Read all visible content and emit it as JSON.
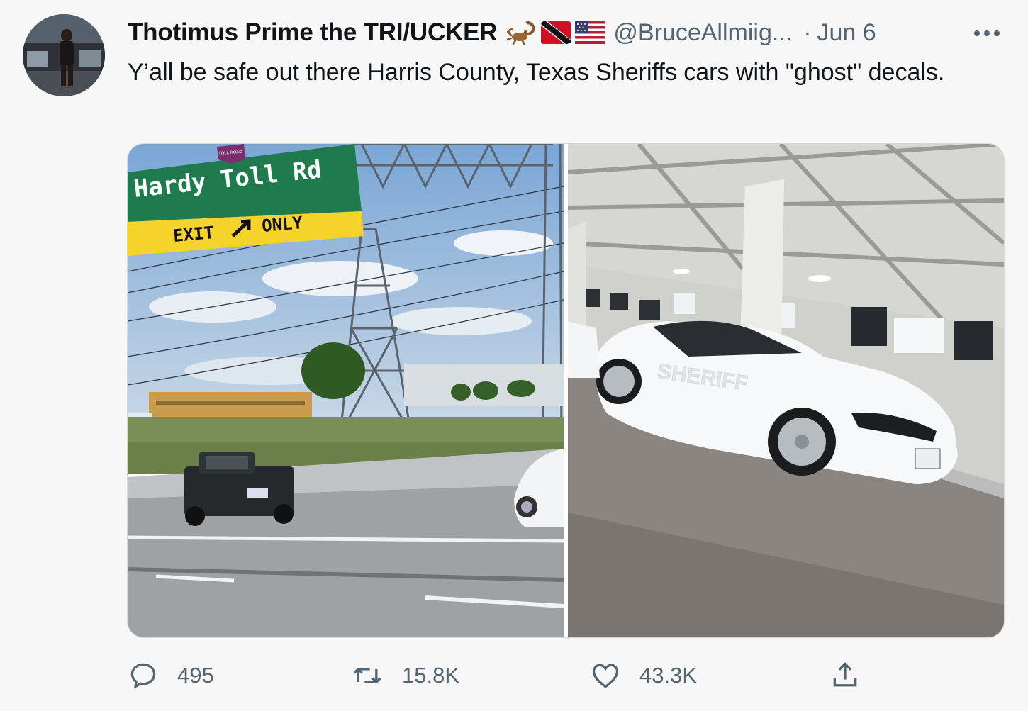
{
  "tweet": {
    "display_name": "Thotimus Prime the TRI/UCKER",
    "handle": "@BruceAllmiig...",
    "dot": "·",
    "date": "Jun 6",
    "text": "Y’all be safe out there Harris County, Texas Sheriffs cars with \"ghost\" decals.",
    "emoji_icons": [
      "scorpion-icon",
      "trinidad-tobago-flag-icon",
      "us-flag-icon"
    ]
  },
  "media": {
    "left_photo": {
      "sign_title": "Hardy Toll Rd",
      "sign_exit": "EXIT",
      "sign_only": "ONLY",
      "shield_text": "TOLL ROAD"
    },
    "right_photo": {
      "door_decal": "SHERIFF"
    }
  },
  "actions": {
    "reply_count": "495",
    "retweet_count": "15.8K",
    "like_count": "43.3K"
  },
  "colors": {
    "background": "#f7f7f7",
    "text": "#0f1419",
    "secondary_text": "#536471",
    "sign_green": "#1f7a4e",
    "sign_yellow": "#f6d32b"
  }
}
